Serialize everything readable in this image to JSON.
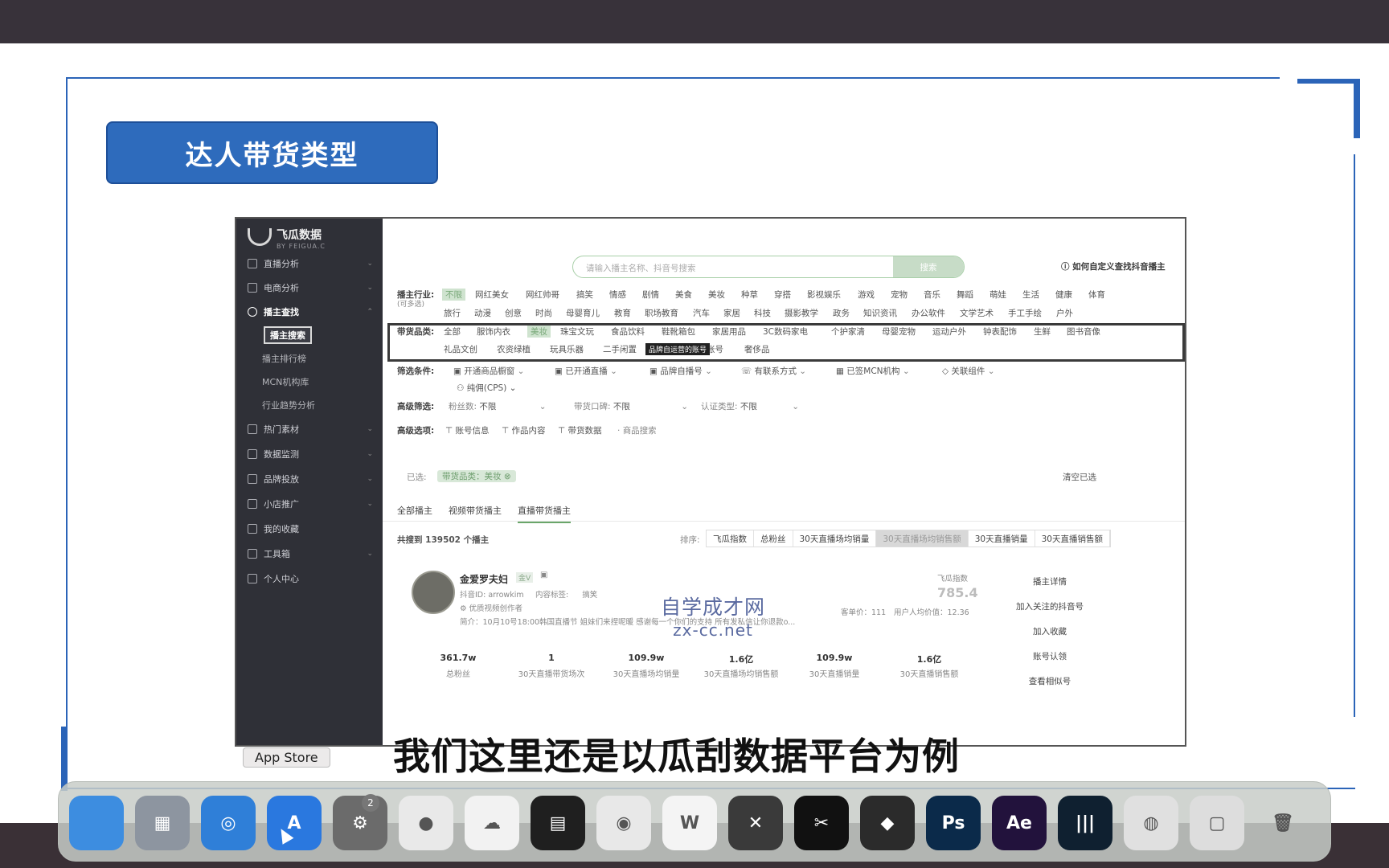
{
  "slide": {
    "title": "达人带货类型",
    "subtitle": "我们这里还是以瓜刮数据平台为例",
    "watermark_line1": "自学成才网",
    "watermark_line2": "zx-cc.net"
  },
  "app": {
    "logo_name": "飞瓜数据",
    "logo_sub": "BY FEIGUA.C",
    "sidebar": {
      "items": [
        {
          "label": "直播分析"
        },
        {
          "label": "电商分析"
        },
        {
          "label": "播主查找"
        },
        {
          "label": "热门素材"
        },
        {
          "label": "数据监测"
        },
        {
          "label": "品牌投放"
        },
        {
          "label": "小店推广"
        },
        {
          "label": "我的收藏"
        },
        {
          "label": "工具箱"
        },
        {
          "label": "个人中心"
        }
      ],
      "sub_items": [
        {
          "label": "播主搜索"
        },
        {
          "label": "播主排行榜"
        },
        {
          "label": "MCN机构库"
        },
        {
          "label": "行业趋势分析"
        }
      ]
    },
    "search": {
      "placeholder": "请输入播主名称、抖音号搜索",
      "button": "搜索"
    },
    "help_link": "如何自定义查找抖音播主",
    "industry": {
      "label": "播主行业:",
      "hint": "(可多选)",
      "row1": [
        "不限",
        "网红美女",
        "网红帅哥",
        "搞笑",
        "情感",
        "剧情",
        "美食",
        "美妆",
        "种草",
        "穿搭",
        "影视娱乐",
        "游戏",
        "宠物",
        "音乐",
        "舞蹈",
        "萌娃",
        "生活",
        "健康",
        "体育"
      ],
      "row2": [
        "旅行",
        "动漫",
        "创意",
        "时尚",
        "母婴育儿",
        "教育",
        "职场教育",
        "汽车",
        "家居",
        "科技",
        "摄影教学",
        "政务",
        "知识资讯",
        "办公软件",
        "文学艺术",
        "手工手绘",
        "户外"
      ]
    },
    "category": {
      "label": "带货品类:",
      "row1": [
        "全部",
        "服饰内衣",
        "美妆",
        "珠宝文玩",
        "食品饮料",
        "鞋靴箱包",
        "家居用品",
        "3C数码家电",
        "个护家清",
        "母婴宠物",
        "运动户外",
        "钟表配饰",
        "生鲜",
        "图书音像"
      ],
      "row2": [
        "礼品文创",
        "农资绿植",
        "玩具乐器",
        "二手闲置",
        "品牌自运营的账号",
        "奢侈品"
      ],
      "tooltip": "品牌自运营的账号"
    },
    "filters": {
      "label": "筛选条件:",
      "items": [
        "开通商品橱窗",
        "已开通直播",
        "品牌自播号",
        "有联系方式",
        "已签MCN机构",
        "关联组件"
      ],
      "extra": "纯佣(CPS)"
    },
    "advanced": {
      "label": "高级筛选:",
      "fans_label": "粉丝数:",
      "fans_value": "不限",
      "reputation_label": "带货口碑:",
      "reputation_value": "不限",
      "cert_label": "认证类型:",
      "cert_value": "不限"
    },
    "options": {
      "label": "高级选项:",
      "items": [
        "账号信息",
        "作品内容",
        "带货数据",
        "商品搜索"
      ]
    },
    "selected": {
      "label": "已选:",
      "chip": "带货品类：美妆",
      "clear": "清空已选"
    },
    "tabs": [
      "全部播主",
      "视频带货播主",
      "直播带货播主"
    ],
    "result_count": "共搜到 139502 个播主",
    "sort": {
      "label": "排序:",
      "items": [
        "飞瓜指数",
        "总粉丝",
        "30天直播场均销量",
        "30天直播场均销售额",
        "30天直播销量",
        "30天直播销售额"
      ]
    },
    "result": {
      "name": "金爱罗夫妇",
      "badge": "金V",
      "douyin_label": "抖音ID:",
      "douyin_id": "arrowkim",
      "tags_label": "内容标签:",
      "tags_value": "搞笑",
      "cert": "优质视频创作者",
      "intro": "简介：10月10号18:00韩国直播节 姐妹们来捏呢暖 感谢每一个你们的支持 所有发私信让你退款o...",
      "index_label": "飞瓜指数",
      "index_value": "785.4",
      "unit_price": "客单价：111",
      "per_value": "用户人均价值：12.36",
      "stats": [
        {
          "value": "361.7w",
          "label": "总粉丝"
        },
        {
          "value": "1",
          "label": "30天直播带货场次"
        },
        {
          "value": "109.9w",
          "label": "30天直播场均销量"
        },
        {
          "value": "1.6亿",
          "label": "30天直播场均销售额"
        },
        {
          "value": "109.9w",
          "label": "30天直播销量"
        },
        {
          "value": "1.6亿",
          "label": "30天直播销售额"
        }
      ],
      "actions": [
        "播主详情",
        "加入关注的抖音号",
        "加入收藏",
        "账号认领",
        "查看相似号"
      ]
    }
  },
  "dock": {
    "tooltip": "App Store",
    "badge": "2",
    "icons": [
      {
        "name": "finder",
        "color": "#3d8de0",
        "glyph": ""
      },
      {
        "name": "launchpad",
        "color": "#8d95a0",
        "glyph": "▦"
      },
      {
        "name": "safari",
        "color": "#2f7fd8",
        "glyph": "◎"
      },
      {
        "name": "app-store",
        "color": "#2a78df",
        "glyph": "A"
      },
      {
        "name": "system-preferences",
        "color": "#6b6b6b",
        "glyph": "⚙"
      },
      {
        "name": "wechat",
        "color": "#e9e9e9",
        "glyph": "●"
      },
      {
        "name": "baidu-netdisk",
        "color": "#f2f2f2",
        "glyph": "☁"
      },
      {
        "name": "final-cut",
        "color": "#1f1f1f",
        "glyph": "▤"
      },
      {
        "name": "netease-music",
        "color": "#e8e8e8",
        "glyph": "◉"
      },
      {
        "name": "wps",
        "color": "#f4f4f4",
        "glyph": "W"
      },
      {
        "name": "x-app",
        "color": "#3a3a3a",
        "glyph": "✕"
      },
      {
        "name": "capcut",
        "color": "#111",
        "glyph": "✂"
      },
      {
        "name": "davinci",
        "color": "#2b2b2b",
        "glyph": "◆"
      },
      {
        "name": "photoshop",
        "color": "#0b2a4a",
        "glyph": "Ps"
      },
      {
        "name": "after-effects",
        "color": "#22123c",
        "glyph": "Ae"
      },
      {
        "name": "audio-app",
        "color": "#0f2030",
        "glyph": "|||"
      },
      {
        "name": "chrome",
        "color": "#e0e0e0",
        "glyph": "◍"
      },
      {
        "name": "preview",
        "color": "#dddddd",
        "glyph": "▢"
      },
      {
        "name": "trash",
        "color": "#cfd4d4",
        "glyph": "🗑"
      }
    ]
  }
}
